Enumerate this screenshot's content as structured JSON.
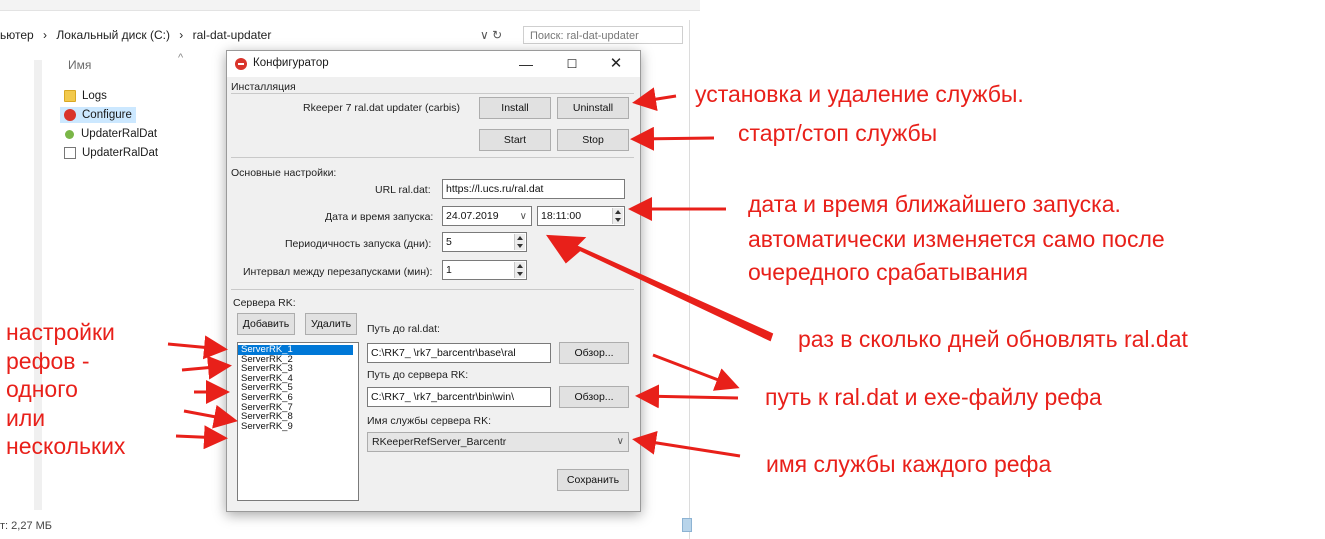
{
  "explorer": {
    "breadcrumb": [
      "ьютер",
      "›",
      "Локальный диск (C:)",
      "›",
      "ral-dat-updater"
    ],
    "search_placeholder": "Поиск: ral-dat-updater",
    "column_name": "Имя",
    "files": [
      {
        "name": "Logs",
        "icon": "folder-icon"
      },
      {
        "name": "Configure",
        "icon": "app-red-icon"
      },
      {
        "name": "UpdaterRalDat",
        "icon": "app-green-icon"
      },
      {
        "name": "UpdaterRalDat",
        "icon": "file-icon"
      }
    ],
    "status": "т: 2,27 МБ"
  },
  "window": {
    "title": "Конфигуратор",
    "controls": {
      "minimize": "—",
      "maximize": "☐",
      "close": "✕"
    },
    "install_group": {
      "title": "Инсталляция",
      "service_label": "Rkeeper 7 ral.dat updater (carbis)",
      "install": "Install",
      "uninstall": "Uninstall",
      "start": "Start",
      "stop": "Stop"
    },
    "settings_group": {
      "title": "Основные настройки:",
      "url_label": "URL ral.dat:",
      "url_value": "https://l.ucs.ru/ral.dat",
      "datetime_label": "Дата и время запуска:",
      "date_value": "24.07.2019",
      "time_value": "18:11:00",
      "period_label": "Периодичность запуска (дни):",
      "period_value": "5",
      "interval_label": "Интервал между перезапусками (мин):",
      "interval_value": "1"
    },
    "servers_group": {
      "title": "Сервера RK:",
      "add": "Добавить",
      "remove": "Удалить",
      "servers": [
        "ServerRK_1",
        "ServerRK_2",
        "ServerRK_3",
        "ServerRK_4",
        "ServerRK_5",
        "ServerRK_6",
        "ServerRK_7",
        "ServerRK_8",
        "ServerRK_9"
      ],
      "ral_path_label": "Путь до ral.dat:",
      "ral_path_value": "C:\\RK7_       \\rk7_barcentr\\base\\ral",
      "browse": "Обзор...",
      "server_path_label": "Путь до сервера RK:",
      "server_path_value": "C:\\RK7_       \\rk7_barcentr\\bin\\win\\",
      "service_name_label": "Имя службы сервера RK:",
      "service_name_value": "RKeeperRefServer_Barcentr",
      "save": "Сохранить"
    }
  },
  "annotations": {
    "install": "установка и удаление службы.",
    "startstop": "старт/стоп службы",
    "datetime_1": "дата и время ближайшего запуска.",
    "datetime_2": "автоматически изменяется само после",
    "datetime_3": "очередного срабатывания",
    "period": "раз в сколько дней обновлять ral.dat",
    "paths": "путь к ral.dat и exe-файлу рефа",
    "service": "имя службы каждого рефа",
    "left_note": [
      "настройки",
      "рефов -",
      "одного",
      "или",
      "нескольких"
    ]
  },
  "colors": {
    "annotation": "#e8201a",
    "selection": "#0078d7"
  }
}
